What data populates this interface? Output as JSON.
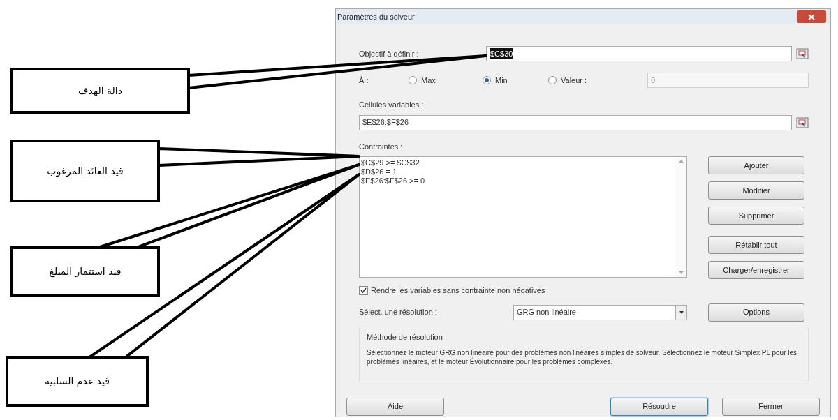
{
  "callouts": [
    {
      "text": "دالة الهدف"
    },
    {
      "text": "قيد العائد المرغوب"
    },
    {
      "text": "قيد استثمار المبلغ"
    },
    {
      "text": "قيد عدم السلبية"
    }
  ],
  "dialog": {
    "title": "Paramètres du solveur",
    "objective": {
      "label": "Objectif à définir :",
      "value": "$C$30"
    },
    "to": {
      "label": "À :",
      "options": [
        {
          "label": "Max",
          "selected": false
        },
        {
          "label": "Min",
          "selected": true
        },
        {
          "label": "Valeur :",
          "selected": false
        }
      ],
      "value_field": "0"
    },
    "variable_cells": {
      "label": "Cellules variables :",
      "value": "$E$26:$F$26"
    },
    "constraints": {
      "label": "Contraintes :",
      "items": [
        "$C$29 >= $C$32",
        "$D$26 = 1",
        "$E$26:$F$26 >= 0"
      ]
    },
    "side_buttons": [
      "Ajouter",
      "Modifier",
      "Supprimer",
      "Rétablir tout",
      "Charger/enregistrer"
    ],
    "nonneg": {
      "label": "Rendre les variables sans contrainte non négatives",
      "checked": true
    },
    "method": {
      "label": "Sélect. une résolution :",
      "value": "GRG non linéaire",
      "button": "Options"
    },
    "description": {
      "title": "Méthode de résolution",
      "text": "Sélectionnez le moteur GRG non linéaire pour des problèmes non linéaires simples de solveur. Sélectionnez le moteur Simplex PL pour les problèmes linéaires, et le moteur Évolutionnaire pour les problèmes complexes."
    },
    "footer_buttons": [
      {
        "label": "Aide",
        "default": false
      },
      {
        "label": "Résoudre",
        "default": true
      },
      {
        "label": "Fermer",
        "default": false
      }
    ]
  }
}
